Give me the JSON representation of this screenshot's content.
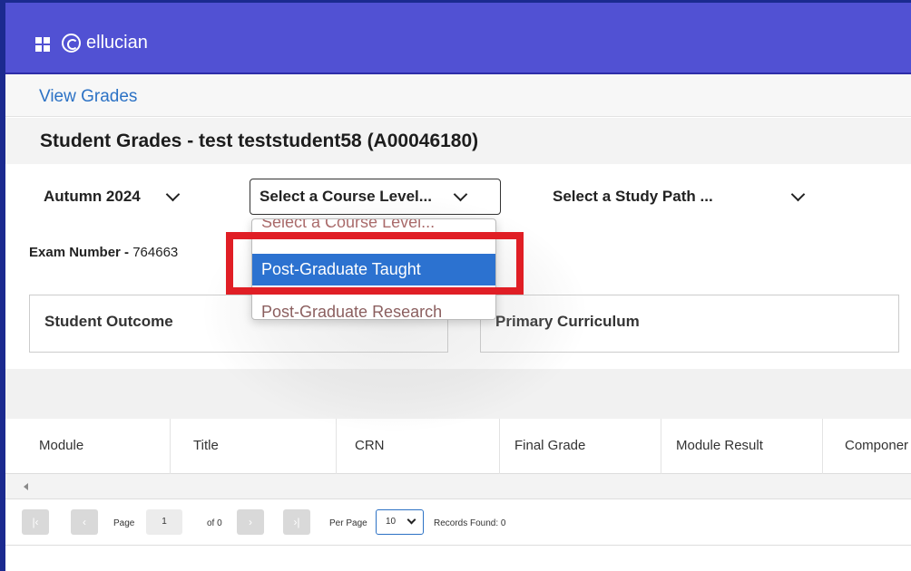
{
  "header": {
    "brand": "ellucian",
    "icons": {
      "apps": "apps-grid-icon",
      "brand": "ellucian-logo-icon"
    }
  },
  "breadcrumb": "View Grades",
  "page_title": "Student Grades - test teststudent58 (A00046180)",
  "filters": {
    "term": "Autumn 2024",
    "course_level": "Select a Course Level...",
    "study_path": "Select a Study Path ..."
  },
  "exam": {
    "label": "Exam Number -",
    "value": "764663"
  },
  "panels": {
    "student_outcome": "Student Outcome",
    "primary_curriculum": "Primary Curriculum"
  },
  "dropdown": {
    "options": [
      "Select a Course Level...",
      "Post-Graduate Taught",
      "Post-Graduate Research"
    ],
    "selected": "Post-Graduate Taught"
  },
  "table": {
    "columns": [
      "Module",
      "Title",
      "CRN",
      "Final Grade",
      "Module Result",
      "Componer"
    ]
  },
  "pager": {
    "page_label": "Page",
    "page_value": "1",
    "of_label": "of 0",
    "per_page_label": "Per Page",
    "per_page_value": "10",
    "records_found": "Records Found: 0"
  },
  "colors": {
    "topbar": "#5151d3",
    "link": "#2c72c5",
    "selected_option": "#2c72d0",
    "highlight": "#e01e25"
  }
}
